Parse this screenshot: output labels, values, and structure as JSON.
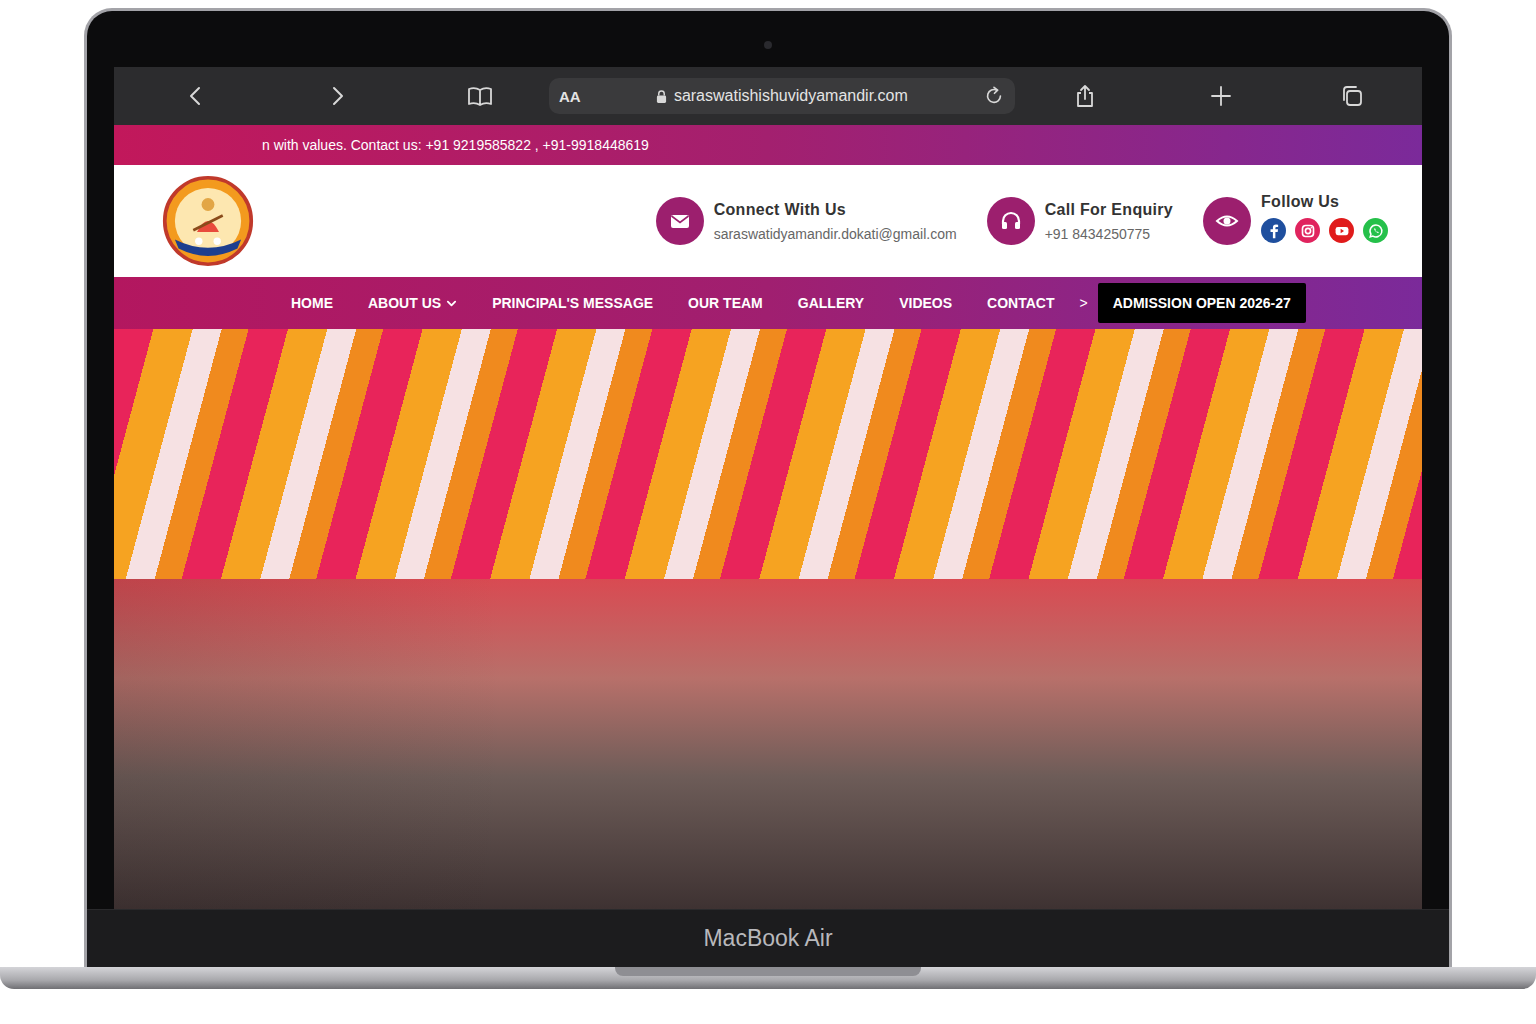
{
  "browser": {
    "aa_label": "AA",
    "url": "saraswatishishuvidyamandir.com"
  },
  "site": {
    "ticker": "n with values. Contact us: +91 9219585822 , +91-9918448619",
    "contacts": [
      {
        "title": "Connect With Us",
        "detail": "saraswatidyamandir.dokati@gmail.com",
        "kind": "mail"
      },
      {
        "title": "Call For Enquiry",
        "detail": "+91 8434250775",
        "kind": "phone"
      }
    ],
    "follow": {
      "title": "Follow Us",
      "networks": [
        {
          "kind": "facebook",
          "color": "#1f4f9e"
        },
        {
          "kind": "instagram",
          "color": "#e0245e"
        },
        {
          "kind": "youtube",
          "color": "#e01b1b"
        },
        {
          "kind": "whatsapp",
          "color": "#25c04a"
        }
      ]
    },
    "nav": [
      {
        "label": "HOME",
        "has_dropdown": false
      },
      {
        "label": "ABOUT US",
        "has_dropdown": true
      },
      {
        "label": "PRINCIPAL'S MESSAGE",
        "has_dropdown": false
      },
      {
        "label": "OUR TEAM",
        "has_dropdown": false
      },
      {
        "label": "GALLERY",
        "has_dropdown": false
      },
      {
        "label": "VIDEOS",
        "has_dropdown": false
      },
      {
        "label": "CONTACT",
        "has_dropdown": false
      }
    ],
    "nav_more": ">",
    "cta": "ADMISSION OPEN 2026-27"
  },
  "laptop": {
    "model": "MacBook Air"
  }
}
